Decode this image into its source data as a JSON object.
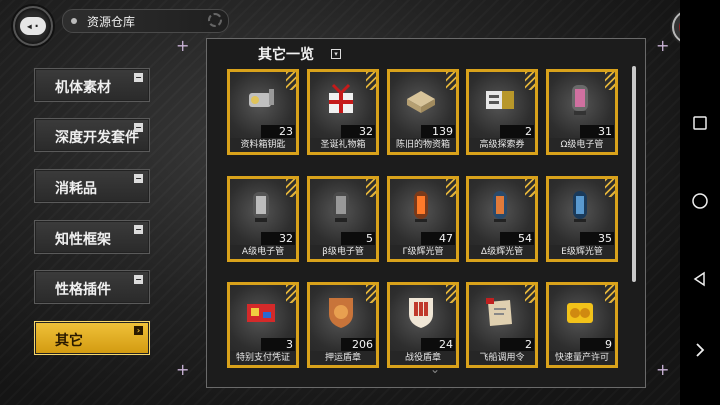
{
  "header": {
    "title": "资源仓库",
    "back_icon": "back-arrow-icon",
    "home_icon": "home-icon"
  },
  "sidebar": {
    "items": [
      {
        "label": "机体素材",
        "mark": "−"
      },
      {
        "label": "深度开发套件",
        "mark": "−"
      },
      {
        "label": "消耗品",
        "mark": "−"
      },
      {
        "label": "知性框架",
        "mark": "−"
      },
      {
        "label": "性格插件",
        "mark": "−"
      },
      {
        "label": "其它",
        "mark": "›"
      }
    ],
    "active_index": 5
  },
  "panel": {
    "title": "其它一览",
    "title_icon": "▾"
  },
  "items": [
    {
      "name": "资料箱钥匙",
      "count": "23",
      "icon": "keys-icon"
    },
    {
      "name": "圣诞礼物箱",
      "count": "32",
      "icon": "gift-box-icon"
    },
    {
      "name": "陈旧的物资箱",
      "count": "139",
      "icon": "supply-box-icon"
    },
    {
      "name": "高级探索券",
      "count": "2",
      "icon": "ticket-icon"
    },
    {
      "name": "Ω级电子管",
      "count": "31",
      "icon": "omega-tube-icon"
    },
    {
      "name": "A级电子管",
      "count": "32",
      "icon": "a-tube-icon"
    },
    {
      "name": "β级电子管",
      "count": "5",
      "icon": "beta-tube-icon"
    },
    {
      "name": "Γ级辉光管",
      "count": "47",
      "icon": "gamma-glow-tube-icon"
    },
    {
      "name": "Δ级辉光管",
      "count": "54",
      "icon": "delta-glow-tube-icon"
    },
    {
      "name": "E级辉光管",
      "count": "35",
      "icon": "e-glow-tube-icon"
    },
    {
      "name": "特别支付凭证",
      "count": "3",
      "icon": "voucher-icon"
    },
    {
      "name": "押运盾章",
      "count": "206",
      "icon": "escort-badge-icon"
    },
    {
      "name": "战役盾章",
      "count": "24",
      "icon": "campaign-badge-icon"
    },
    {
      "name": "飞船调用令",
      "count": "2",
      "icon": "ship-order-icon"
    },
    {
      "name": "快速量产许可",
      "count": "9",
      "icon": "permit-icon"
    }
  ],
  "colors": {
    "accent": "#d9a21b",
    "active_tab": "#f0c23a",
    "background": "#1a1a1a"
  }
}
